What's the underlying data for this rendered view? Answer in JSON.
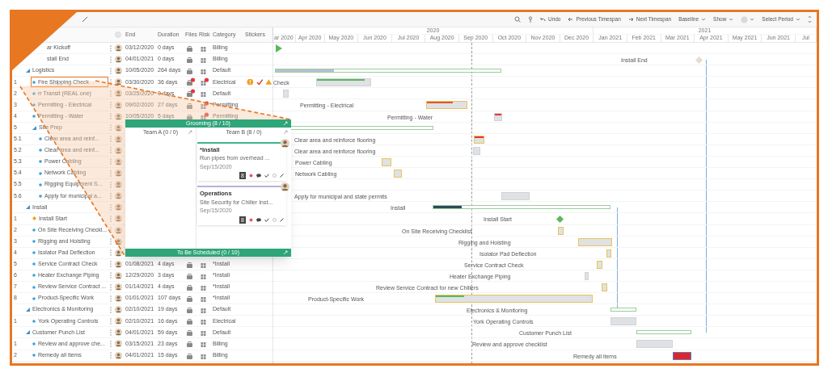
{
  "toolbar": {
    "undo": "Undo",
    "previous": "Previous Timespan",
    "next": "Next Timespan",
    "baseline": "Baseline",
    "show": "Show",
    "period": "Select Period"
  },
  "grid_columns": [
    "End",
    "Duration",
    "Files",
    "Risk",
    "Category",
    "Stickers"
  ],
  "timeline": {
    "years": [
      "2020",
      "2021"
    ],
    "months": [
      "ar 2020",
      "Apr 2020",
      "May 2020",
      "Jun 2020",
      "Jul 2020",
      "Aug 2020",
      "Sep 2020",
      "Oct 2020",
      "Nov 2020",
      "Dec 2020",
      "Jan 2021",
      "Feb 2021",
      "Mar 2021",
      "Apr 2021",
      "May 2021",
      "Jun 2021",
      "Jul"
    ]
  },
  "rows": [
    {
      "name": "ar Kickoff",
      "kind": "plain",
      "selected": false,
      "end": "03/12/2020",
      "duration": "0 days",
      "files_alert": false,
      "risk_alert": false,
      "category": "Billing"
    },
    {
      "name": "stall End",
      "kind": "plain",
      "selected": false,
      "end": "04/01/2021",
      "duration": "0 days",
      "files_alert": false,
      "risk_alert": false,
      "category": "Billing",
      "gantt": {
        "label": "Install End"
      }
    },
    {
      "name": "Logistics",
      "kind": "summary",
      "expanded": true,
      "selected": false,
      "end": "10/05/2020",
      "duration": "264 days",
      "files_alert": false,
      "risk_alert": false,
      "category": "Default",
      "gantt": {
        "level": 0.26
      },
      "children": [
        {
          "wbs": "1",
          "name": "Fire Shipping Check",
          "kind": "task",
          "selected": true,
          "end": "03/30/2020",
          "duration": "36 days",
          "files_alert": true,
          "risk_alert": true,
          "category": "Electrical",
          "stickers": [
            {
              "kind": "alert"
            },
            {
              "kind": "check"
            },
            {
              "kind": "warning"
            }
          ],
          "gantt": {
            "label": "Check",
            "level": 0.9
          }
        },
        {
          "wbs": "2",
          "name": "rr Transit (REAL one)",
          "kind": "task",
          "selected": false,
          "end": "03/25/2020",
          "duration": "0 days",
          "files_alert": true,
          "risk_alert": false,
          "category": "Default"
        },
        {
          "wbs": "3",
          "name": "Permitting - Electrical",
          "kind": "task",
          "selected": false,
          "end": "09/02/2020",
          "duration": "27 days",
          "files_alert": false,
          "risk_alert": true,
          "category": "Permitting",
          "gantt": {
            "label": "Permitting - Electrical",
            "level": 0.65
          }
        },
        {
          "wbs": "4",
          "name": "Permitting - Water",
          "kind": "task",
          "selected": false,
          "end": "10/05/2020",
          "duration": "5 days",
          "files_alert": false,
          "risk_alert": true,
          "category": "Permitting",
          "gantt": {
            "label": "Permitting - Water"
          }
        },
        {
          "wbs": "5",
          "name": "Site Prep",
          "kind": "summary",
          "expanded": true,
          "selected": false,
          "children": [
            {
              "wbs": "5.1",
              "name": "Clear area and reinf...",
              "kind": "task",
              "selected": false,
              "gantt": {
                "label": "Clear area and reinforce flooring"
              }
            },
            {
              "wbs": "5.2",
              "name": "Clear area and reinf...",
              "kind": "task",
              "selected": false,
              "gantt": {
                "label": "Clear area and reinforce flooring"
              }
            },
            {
              "wbs": "5.3",
              "name": "Power Cabling",
              "kind": "task",
              "selected": false,
              "gantt": {
                "label": "Power Cabling"
              }
            },
            {
              "wbs": "5.4",
              "name": "Network Cabling",
              "kind": "task",
              "selected": false,
              "gantt": {
                "label": "Network Cabling"
              }
            },
            {
              "wbs": "5.5",
              "name": "Rigging Equipment S...",
              "kind": "task",
              "selected": false
            },
            {
              "wbs": "5.6",
              "name": "Apply for municipal a...",
              "kind": "task",
              "selected": false,
              "gantt": {
                "label": "Apply for municipal and state permits"
              }
            }
          ]
        }
      ]
    },
    {
      "name": "Install",
      "kind": "summary",
      "expanded": true,
      "selected": false,
      "gantt": {
        "label": "Install",
        "level": 0.16
      },
      "children": [
        {
          "wbs": "1",
          "name": "Install Start",
          "kind": "milestone",
          "selected": false,
          "gantt": {
            "label": "Install Start"
          }
        },
        {
          "wbs": "2",
          "name": "On Site Receiving Checkl...",
          "kind": "task",
          "selected": false,
          "gantt": {
            "label": "On Site Receiving Checklist"
          }
        },
        {
          "wbs": "3",
          "name": "Rigging and Hoisting",
          "kind": "task",
          "selected": false,
          "gantt": {
            "label": "Rigging and Hoisting"
          }
        },
        {
          "wbs": "4",
          "name": "Isolator Pad Deflection",
          "kind": "task",
          "selected": false,
          "gantt": {
            "label": "Isolator Pad Deflection"
          }
        },
        {
          "wbs": "5",
          "name": "Service Contract Check",
          "kind": "task",
          "selected": false,
          "end": "01/08/2021",
          "duration": "4 days",
          "files_alert": false,
          "risk_alert": false,
          "category": "*Install",
          "gantt": {
            "label": "Service Contract Check"
          }
        },
        {
          "wbs": "6",
          "name": "Heater Exchange Piping",
          "kind": "task",
          "selected": false,
          "end": "12/29/2020",
          "duration": "3 days",
          "files_alert": false,
          "risk_alert": false,
          "category": "*Install",
          "gantt": {
            "label": "Heater Exchange Piping"
          }
        },
        {
          "wbs": "7",
          "name": "Review Service Contract ...",
          "kind": "task",
          "selected": false,
          "end": "01/14/2021",
          "duration": "4 days",
          "files_alert": false,
          "risk_alert": false,
          "category": "*Install",
          "gantt": {
            "label": "Review Service Contract for new Chillers"
          }
        },
        {
          "wbs": "8",
          "name": "Product-Specific Work",
          "kind": "task",
          "selected": false,
          "end": "01/01/2021",
          "duration": "107 days",
          "files_alert": false,
          "risk_alert": false,
          "category": "*Install",
          "gantt": {
            "label": "Product-Specific Work",
            "level": 0.18
          }
        }
      ]
    },
    {
      "name": "Electronics & Monitoring",
      "kind": "summary",
      "expanded": true,
      "selected": false,
      "end": "02/10/2021",
      "duration": "19 days",
      "files_alert": false,
      "risk_alert": false,
      "category": "Default",
      "gantt": {
        "label": "Electronics & Monitoring"
      },
      "children": [
        {
          "wbs": "1",
          "name": "York Operating Controls",
          "kind": "task",
          "selected": false,
          "end": "02/10/2021",
          "duration": "16 days",
          "files_alert": false,
          "risk_alert": false,
          "category": "Electrical",
          "gantt": {
            "label": "York Operating Controls"
          }
        }
      ]
    },
    {
      "name": "Customer Punch List",
      "kind": "summary",
      "expanded": true,
      "selected": false,
      "end": "04/01/2021",
      "duration": "59 days",
      "files_alert": false,
      "risk_alert": false,
      "category": "Default",
      "gantt": {
        "label": "Customer Punch List"
      },
      "children": [
        {
          "wbs": "1",
          "name": "Review and approve che...",
          "kind": "task",
          "selected": false,
          "end": "03/15/2021",
          "duration": "23 days",
          "files_alert": false,
          "risk_alert": false,
          "category": "Billing",
          "gantt": {
            "label": "Review and approve checklist"
          }
        },
        {
          "wbs": "2",
          "name": "Remedy all items",
          "kind": "task",
          "selected": false,
          "end": "04/01/2021",
          "duration": "15 days",
          "files_alert": false,
          "risk_alert": false,
          "category": "Billing",
          "gantt": {
            "label": "Remedy all items"
          }
        }
      ]
    }
  ],
  "popup": {
    "title": "Grooming (8 / 10)",
    "columns": [
      {
        "title": "Team A (0 / 0)"
      },
      {
        "title": "Team B (8 / 0)",
        "cards": [
          {
            "title": "*Install",
            "text": "Run pipes from overhead ...",
            "date": "Sep/15/2020",
            "badge": "8",
            "color": "#3fb68b"
          },
          {
            "title": "Operations",
            "text": "Site Security for Chiller Inst...",
            "date": "Sep/15/2020",
            "badge": "8",
            "color": "#b7b2dc"
          }
        ]
      }
    ],
    "footer": "To Be Scheduled (0 / 10)"
  }
}
